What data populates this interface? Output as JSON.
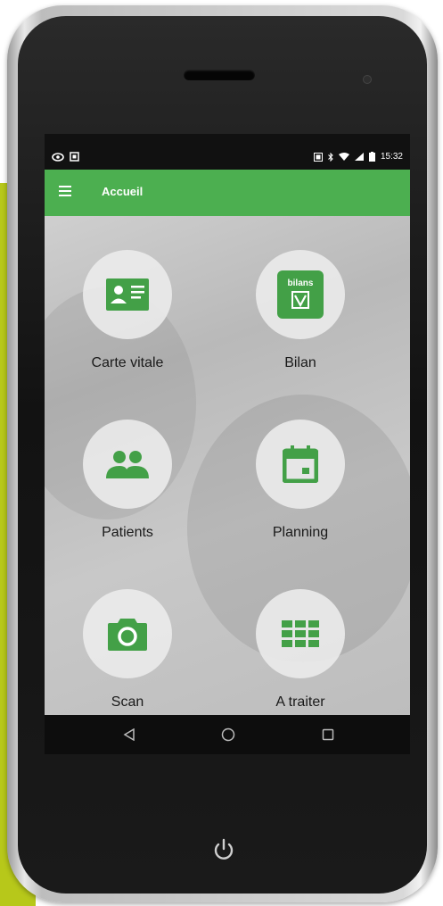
{
  "status_bar": {
    "time": "15:32"
  },
  "app_bar": {
    "title": "Accueil"
  },
  "tiles": [
    {
      "label": "Carte vitale",
      "icon": "id-card-icon"
    },
    {
      "label": "Bilan",
      "icon": "bilans-doc-icon",
      "badge": "bilans"
    },
    {
      "label": "Patients",
      "icon": "people-icon"
    },
    {
      "label": "Planning",
      "icon": "calendar-icon"
    },
    {
      "label": "Scan",
      "icon": "camera-icon"
    },
    {
      "label": "A traiter",
      "icon": "grid-icon"
    }
  ],
  "colors": {
    "accent": "#4caf50",
    "icon_green": "#43a047",
    "side_strip": "#b7c81a"
  }
}
